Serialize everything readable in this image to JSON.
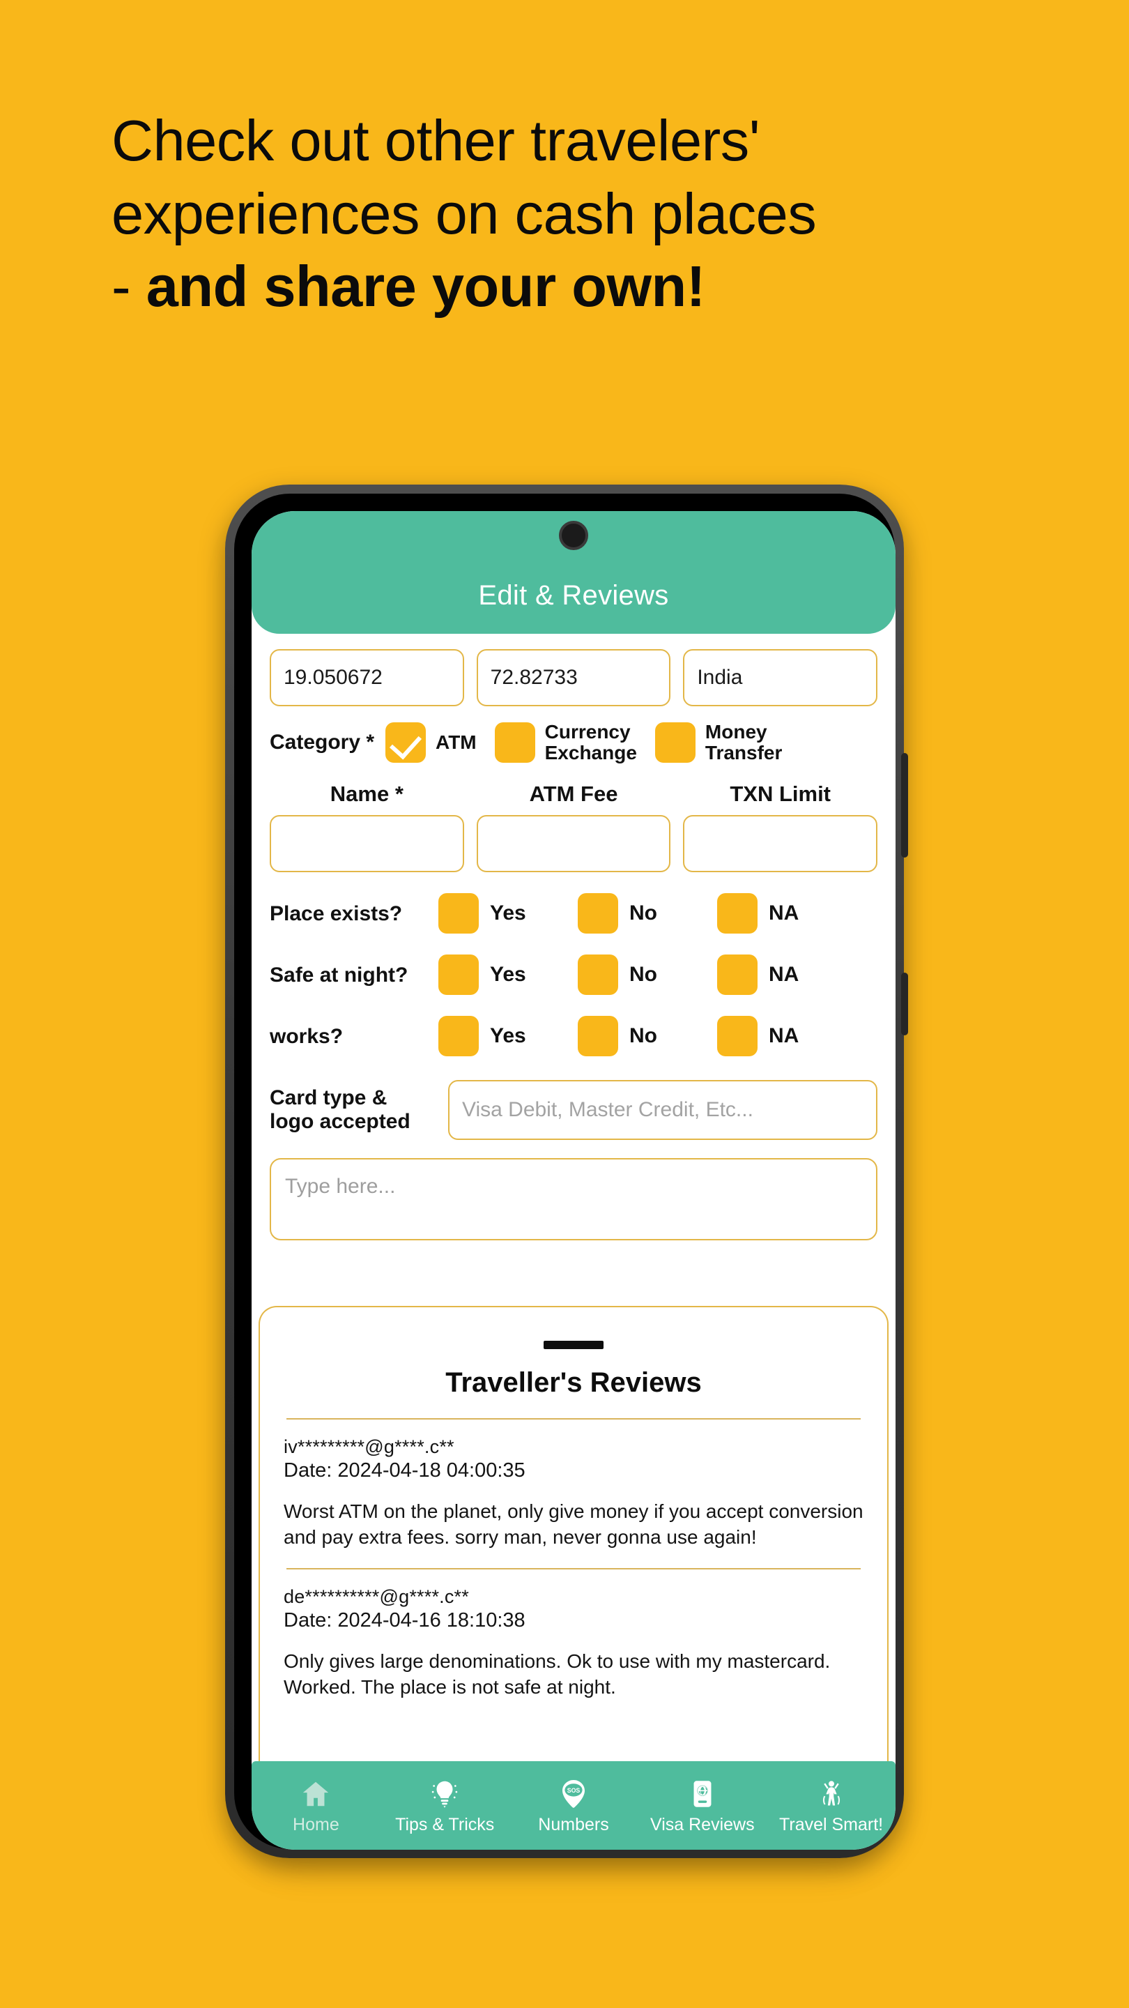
{
  "promo": {
    "background_color": "#F9B71A",
    "headline_lines": [
      {
        "text": "Check out other travelers'",
        "bold": false
      },
      {
        "text": "experiences on cash places",
        "bold": false
      }
    ],
    "headline_last_prefix": "- ",
    "headline_last_bold": "and share your own!"
  },
  "app": {
    "accent_teal": "#4FBC9D",
    "accent_yellow": "#F9B71A",
    "border_gold": "#E3B748",
    "header": {
      "title": "Edit & Reviews"
    },
    "location": {
      "latitude": "19.050672",
      "longitude": "72.82733",
      "country": "India"
    },
    "category": {
      "label": "Category *",
      "options": [
        {
          "label": "ATM",
          "label2": "",
          "checked": true
        },
        {
          "label": "Currency",
          "label2": "Exchange",
          "checked": false
        },
        {
          "label": "Money",
          "label2": "Transfer",
          "checked": false
        }
      ]
    },
    "detail_fields": [
      {
        "header": "Name *",
        "value": ""
      },
      {
        "header": "ATM Fee",
        "value": ""
      },
      {
        "header": "TXN Limit",
        "value": ""
      }
    ],
    "questions": [
      {
        "label": "Place exists?",
        "options": [
          "Yes",
          "No",
          "NA"
        ]
      },
      {
        "label": "Safe at night?",
        "options": [
          "Yes",
          "No",
          "NA"
        ]
      },
      {
        "label": "works?",
        "options": [
          "Yes",
          "No",
          "NA"
        ]
      }
    ],
    "card_type": {
      "label_line1": "Card type &",
      "label_line2": "logo accepted",
      "placeholder": "Visa Debit, Master Credit, Etc..."
    },
    "comment": {
      "placeholder": "Type here..."
    },
    "reviews_section": {
      "title": "Traveller's Reviews",
      "reviews": [
        {
          "email": "iv*********@g****.c**",
          "date": "Date: 2024-04-18 04:00:35",
          "text": "Worst ATM on the planet, only give money if you accept conversion and pay extra fees. sorry man, never gonna use again!"
        },
        {
          "email": "de**********@g****.c**",
          "date": "Date: 2024-04-16 18:10:38",
          "text": "Only gives large denominations. Ok to use with my mastercard. Worked. The place is not safe at night."
        }
      ]
    },
    "bottom_nav": [
      {
        "label": "Home",
        "icon": "home-icon",
        "active": false
      },
      {
        "label": "Tips & Tricks",
        "icon": "lightbulb-icon",
        "active": true
      },
      {
        "label": "Numbers",
        "icon": "sos-pin-icon",
        "active": true
      },
      {
        "label": "Visa Reviews",
        "icon": "passport-globe-icon",
        "active": true
      },
      {
        "label": "Travel Smart!",
        "icon": "traveler-icon",
        "active": true
      }
    ]
  }
}
